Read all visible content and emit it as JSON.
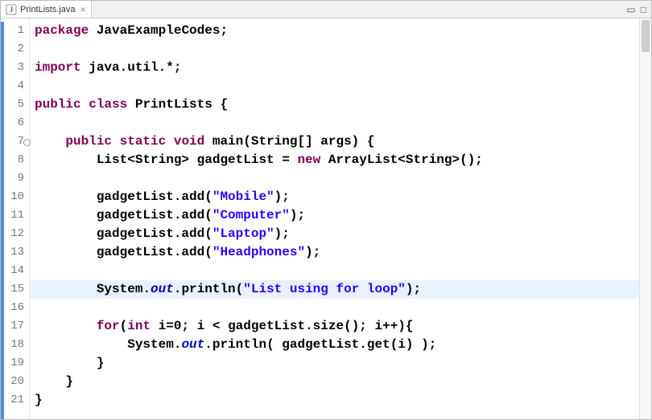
{
  "tab": {
    "filename": "PrintLists.java"
  },
  "gutter": {
    "numbers": [
      "1",
      "2",
      "3",
      "4",
      "5",
      "6",
      "7",
      "8",
      "9",
      "10",
      "11",
      "12",
      "13",
      "14",
      "15",
      "16",
      "17",
      "18",
      "19",
      "20",
      "21"
    ],
    "override_marker_line": 7,
    "highlight_line": 15
  },
  "code": {
    "tokens": [
      [
        [
          "kw",
          "package"
        ],
        [
          "plain",
          " JavaExampleCodes;"
        ]
      ],
      [],
      [
        [
          "kw",
          "import"
        ],
        [
          "plain",
          " java.util.*;"
        ]
      ],
      [],
      [
        [
          "kw",
          "public"
        ],
        [
          "plain",
          " "
        ],
        [
          "kw",
          "class"
        ],
        [
          "plain",
          " PrintLists {"
        ]
      ],
      [],
      [
        [
          "plain",
          "    "
        ],
        [
          "kw",
          "public"
        ],
        [
          "plain",
          " "
        ],
        [
          "kw",
          "static"
        ],
        [
          "plain",
          " "
        ],
        [
          "kw",
          "void"
        ],
        [
          "plain",
          " main(String[] args) {"
        ]
      ],
      [
        [
          "plain",
          "        List<String> gadgetList = "
        ],
        [
          "kw",
          "new"
        ],
        [
          "plain",
          " ArrayList<String>();"
        ]
      ],
      [],
      [
        [
          "plain",
          "        gadgetList.add("
        ],
        [
          "str",
          "\"Mobile\""
        ],
        [
          "plain",
          ");"
        ]
      ],
      [
        [
          "plain",
          "        gadgetList.add("
        ],
        [
          "str",
          "\"Computer\""
        ],
        [
          "plain",
          ");"
        ]
      ],
      [
        [
          "plain",
          "        gadgetList.add("
        ],
        [
          "str",
          "\"Laptop\""
        ],
        [
          "plain",
          ");"
        ]
      ],
      [
        [
          "plain",
          "        gadgetList.add("
        ],
        [
          "str",
          "\"Headphones\""
        ],
        [
          "plain",
          ");"
        ]
      ],
      [],
      [
        [
          "plain",
          "        System."
        ],
        [
          "fld",
          "out"
        ],
        [
          "plain",
          ".println("
        ],
        [
          "str",
          "\"List using for loop\""
        ],
        [
          "plain",
          ");"
        ]
      ],
      [],
      [
        [
          "plain",
          "        "
        ],
        [
          "kw",
          "for"
        ],
        [
          "plain",
          "("
        ],
        [
          "kw",
          "int"
        ],
        [
          "plain",
          " i=0; i < gadgetList.size(); i++){"
        ]
      ],
      [
        [
          "plain",
          "            System."
        ],
        [
          "fld",
          "out"
        ],
        [
          "plain",
          ".println( gadgetList.get(i) );"
        ]
      ],
      [
        [
          "plain",
          "        }"
        ]
      ],
      [
        [
          "plain",
          "    }"
        ]
      ],
      [
        [
          "plain",
          "}"
        ]
      ]
    ]
  }
}
